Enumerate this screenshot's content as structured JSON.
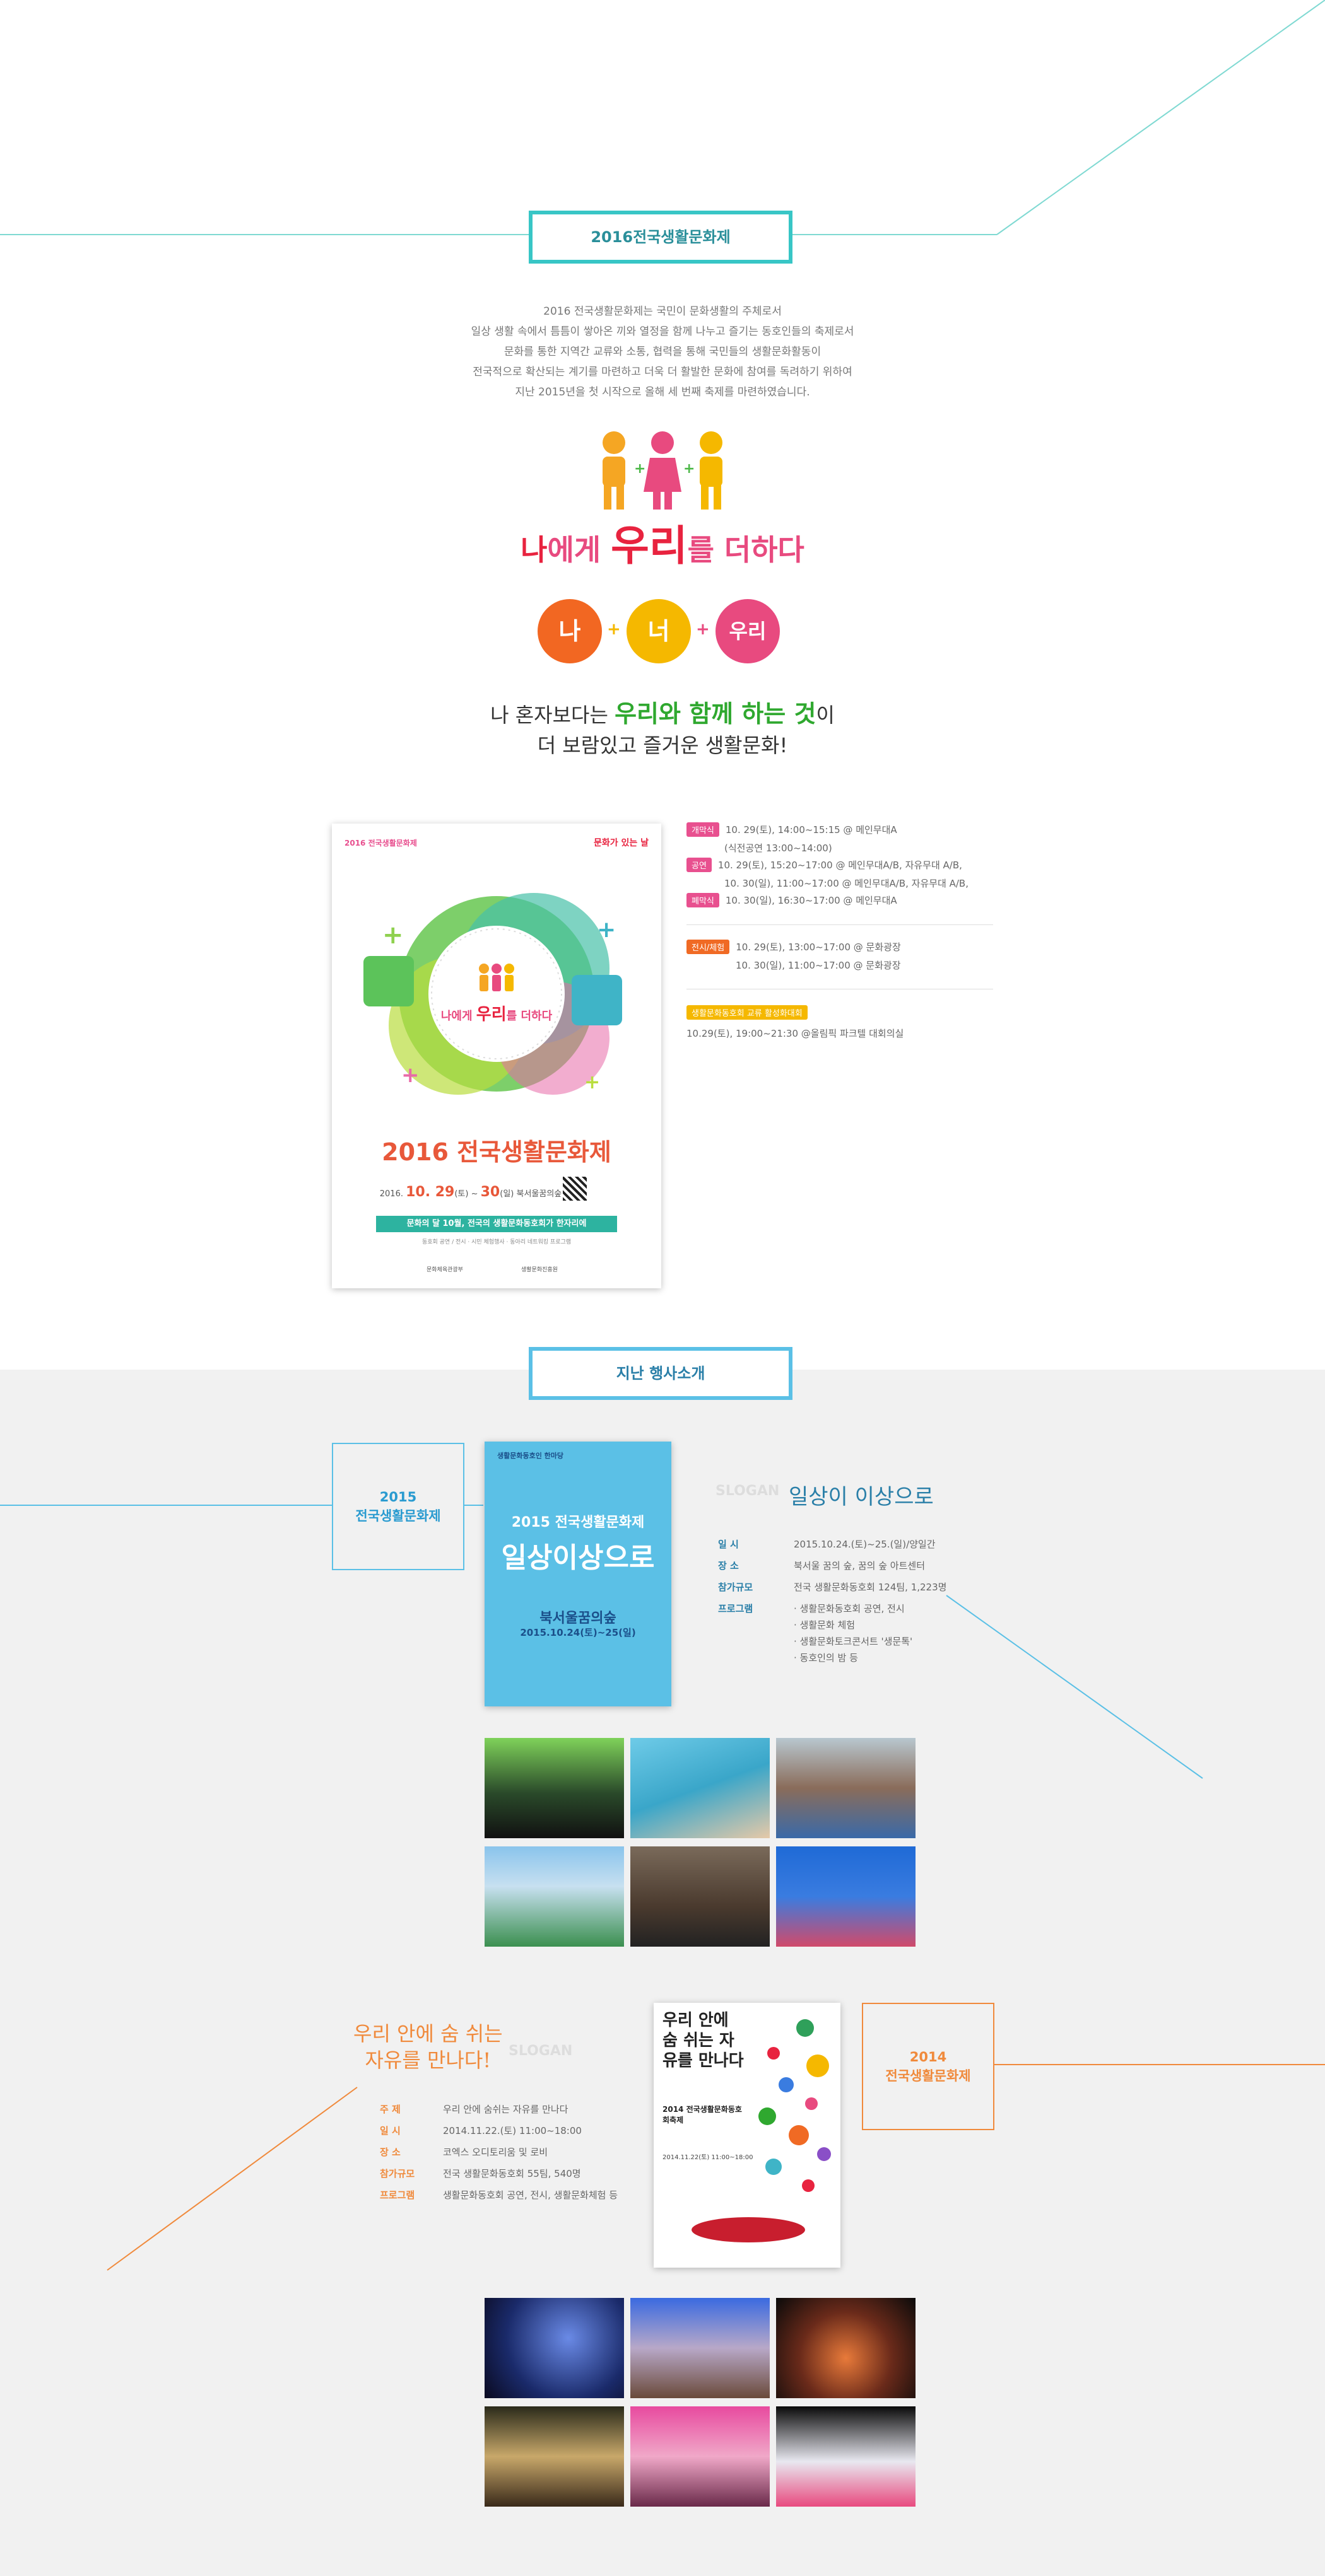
{
  "festival": {
    "title": "2016전국생활문화제",
    "intro": [
      "2016 전국생활문화제는 국민이 문화생활의 주체로서",
      "일상 생활 속에서 틈틈이 쌓아온 끼와 열정을 함께 나누고 즐기는 동호인들의 축제로서",
      "문화를 통한 지역간 교류와 소통, 협력을 통해 국민들의 생활문화활동이",
      "전국적으로 확산되는 계기를 마련하고 더욱 더 활발한 문화에 참여를 독려하기 위하여",
      "지난 2015년을 첫 시작으로 올해 세 번째 축제를 마련하였습니다."
    ],
    "slogan": {
      "pre": "나",
      "mid1": "에게 ",
      "highlight": "우리",
      "post": "를 더하다"
    },
    "circles": [
      "나",
      "너",
      "우리"
    ],
    "tagline": {
      "line1_pre": "나 혼자보다는 ",
      "line1_highlight": "우리와 함께 하는 것",
      "line1_post": "이",
      "line2": "더 보람있고 즐거운 생활문화!"
    },
    "poster": {
      "top_left": "2016 전국생활문화제",
      "top_right": "문화가 있는 날",
      "center_slogan_pre": "나에게 ",
      "center_slogan_hl": "우리",
      "center_slogan_post": "를 더하다",
      "big_title": "2016 전국생활문화제",
      "dates_prefix": "2016.",
      "dates_hl": "10. 29",
      "dates_mid": "(토) ~ ",
      "dates_hl2": "30",
      "dates_suffix": "(일) 북서울꿈의숲",
      "banner": "문화의 달 10월, 전국의 생활문화동호회가 한자리에",
      "sub": "동호회 공연 / 전시 · 시민 체험행사 · 동아리 네트워킹 프로그램",
      "footer_left": "문화체육관광부",
      "footer_right": "생활문화진흥원"
    },
    "schedule": [
      {
        "badge": "개막식",
        "badge_color": "#e8508f",
        "lines": [
          "10. 29(토), 14:00~15:15 @ 메인무대A",
          "(식전공연 13:00~14:00)"
        ]
      },
      {
        "badge": "공연",
        "badge_color": "#e8508f",
        "lines": [
          "10. 29(토), 15:20~17:00 @ 메인무대A/B, 자유무대 A/B,",
          "10. 30(일), 11:00~17:00 @ 메인무대A/B, 자유무대 A/B,"
        ]
      },
      {
        "badge": "폐막식",
        "badge_color": "#e8508f",
        "lines": [
          "10. 30(일), 16:30~17:00 @ 메인무대A"
        ]
      },
      {
        "badge": "전시/체험",
        "badge_color": "#f06a24",
        "lines": [
          "10. 29(토), 13:00~17:00 @ 문화광장",
          "10. 30(일), 11:00~17:00 @ 문화광장"
        ]
      },
      {
        "badge": "생활문화동호회 교류 활성화대회",
        "badge_color": "#f5b800",
        "lines": [
          "10.29(토), 19:00~21:30 @올림픽 파크텔 대회의실"
        ]
      }
    ]
  },
  "past": {
    "title": "지난 행사소개",
    "y2015": {
      "year_label": "2015\n전국생활문화제",
      "slogan_tag": "SLOGAN",
      "slogan": "일상이 이상으로",
      "poster_top": "생활문화동호인 한마당",
      "poster_title": "2015 전국생활문화제",
      "poster_big": "일상이상으로",
      "poster_place": "북서울꿈의숲",
      "poster_dates": "2015.10.24(토)~25(일)",
      "rows": [
        {
          "label": "일 시",
          "value": "2015.10.24.(토)~25.(일)/양일간"
        },
        {
          "label": "장 소",
          "value": "북서울 꿈의 숲, 꿈의 숲 아트센터"
        },
        {
          "label": "참가규모",
          "value": "전국 생활문화동호회 124팀, 1,223명"
        },
        {
          "label": "프로그램",
          "value": "· 생활문화동호회 공연, 전시"
        },
        {
          "label": "",
          "value": "· 생활문화 체험"
        },
        {
          "label": "",
          "value": "· 생활문화토크콘서트 '생문톡'"
        },
        {
          "label": "",
          "value": "· 동호인의 밤 등"
        }
      ]
    },
    "y2014": {
      "year_label": "2014\n전국생활문화제",
      "slogan_tag": "SLOGAN",
      "slogan_line1": "우리 안에 숨 쉬는",
      "slogan_line2": "자유를 만나다!",
      "poster_title": "우리 안에 숨 쉬는 자유를 만나다",
      "poster_event": "2014 전국생활문화동호회축제",
      "poster_date": "2014.11.22(토) 11:00~18:00",
      "rows": [
        {
          "label": "주 제",
          "value": "우리 안에 숨쉬는 자유를 만나다"
        },
        {
          "label": "일 시",
          "value": "2014.11.22.(토) 11:00~18:00"
        },
        {
          "label": "장 소",
          "value": "코엑스 오디토리움 및 로비"
        },
        {
          "label": "참가규모",
          "value": "전국 생활문화동호회 55팀, 540명"
        },
        {
          "label": "프로그램",
          "value": "생활문화동호회 공연, 전시, 생활문화체험 등"
        }
      ]
    }
  },
  "colors": {
    "teal": "#38c6c6",
    "blue": "#5bc0e6",
    "orange": "#f08a3c",
    "pink": "#e8508f",
    "yellow": "#f5b800",
    "green": "#2fa82f",
    "bg_gray": "#f1f1f1"
  }
}
